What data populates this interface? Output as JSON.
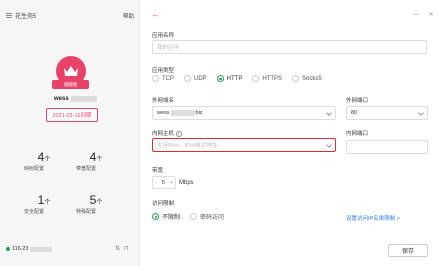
{
  "sidebar": {
    "title": "花生壳5",
    "help": "帮助",
    "badge": "旗舰版",
    "username_prefix": "wess",
    "expire": "2021-03-16到期",
    "stats": [
      {
        "num": "4",
        "unit": "个",
        "label": "映射配置"
      },
      {
        "num": "4",
        "unit": "个",
        "label": "带宽配置"
      },
      {
        "num": "1",
        "unit": "个",
        "label": "安全配置"
      },
      {
        "num": "5",
        "unit": "个",
        "label": "特殊配置"
      }
    ],
    "footer_ip_prefix": "116.23",
    "colors": {
      "accent": "#e8426b",
      "online": "#21a35a"
    }
  },
  "main": {
    "app_name": {
      "label": "应用名称",
      "placeholder": "我的应用"
    },
    "app_type": {
      "label": "应用类型",
      "options": [
        "TCP",
        "UDP",
        "HTTP",
        "HTTPS",
        "Socks5"
      ],
      "selected": "HTTP"
    },
    "ext_domain": {
      "label": "外网域名",
      "value_prefix": "wess",
      "value_suffix": "biz"
    },
    "ext_port": {
      "label": "外网端口",
      "value": "80"
    },
    "int_host": {
      "label": "内网主机",
      "placeholder": "支持IPv4、IPv6格式地址"
    },
    "int_port": {
      "label": "内网端口"
    },
    "bandwidth": {
      "label": "带宽",
      "value": "5",
      "minus": "-",
      "plus": "+",
      "unit": "Mbps"
    },
    "access": {
      "label": "访问限制",
      "options": [
        "不限制",
        "密码访问"
      ],
      "selected": "不限制",
      "link": "设置访问IP名单限制 >"
    },
    "save": "保存"
  }
}
